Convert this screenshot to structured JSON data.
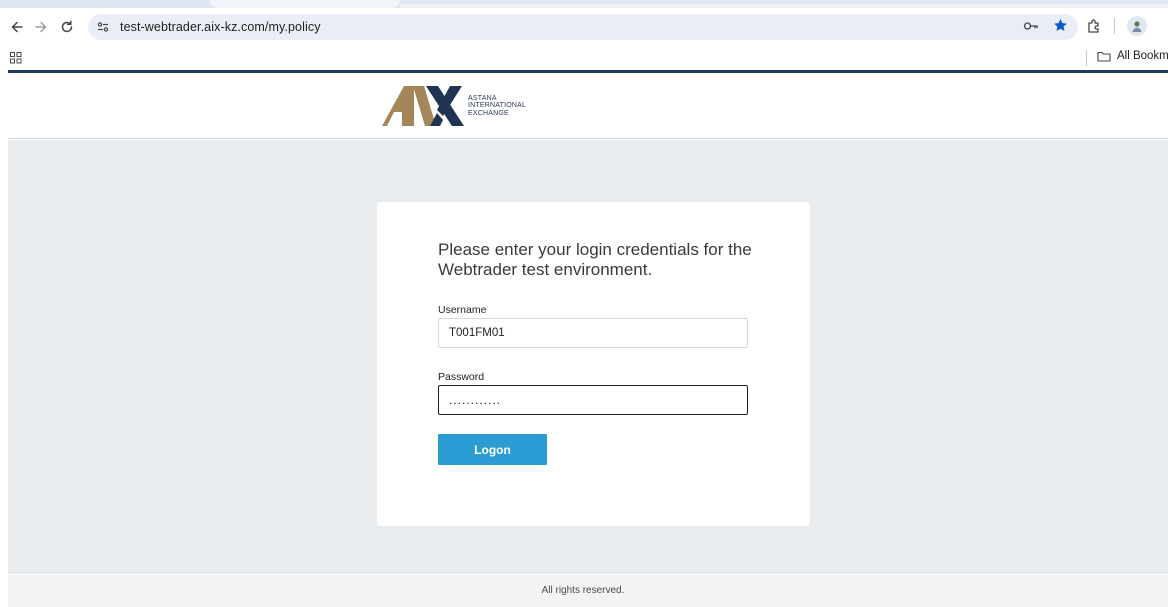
{
  "browser": {
    "url": "test-webtrader.aix-kz.com/my.policy",
    "bookmarks_label": "All Bookmarks"
  },
  "header": {
    "logo_mark": "AIX",
    "logo_lines": [
      "ASTANA",
      "INTERNATIONAL",
      "EXCHANGE"
    ],
    "brand_colors": {
      "gold": "#a3865a",
      "navy": "#1f3452"
    }
  },
  "login": {
    "heading": "Please enter your login credentials for the Webtrader test environment.",
    "username_label": "Username",
    "username_value": "T001FM01",
    "password_label": "Password",
    "password_value": "............",
    "submit_label": "Logon"
  },
  "footer": {
    "text": "All rights reserved."
  },
  "colors": {
    "accent": "#2b9bd3",
    "page_bg": "#eaedf0"
  }
}
